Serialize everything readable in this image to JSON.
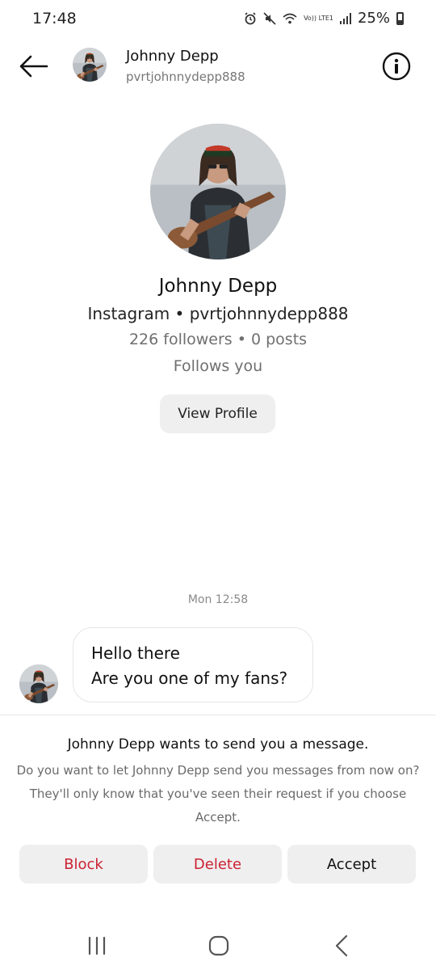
{
  "status_bar": {
    "time": "17:48",
    "network_label": "Vo)) LTE1",
    "battery": "25%",
    "icons": [
      "alarm-icon",
      "mute-icon",
      "wifi-icon",
      "lte-icon",
      "signal-icon",
      "battery-icon"
    ]
  },
  "header": {
    "name": "Johnny Depp",
    "handle": "pvrtjohnnydepp888",
    "back_icon": "arrow-left-icon",
    "info_icon": "info-circle-icon"
  },
  "profile": {
    "name": "Johnny Depp",
    "subtitle": "Instagram • pvrtjohnnydepp888",
    "stats": "226 followers • 0 posts",
    "follows": "Follows you",
    "view_profile_label": "View Profile"
  },
  "conversation": {
    "timestamp": "Mon 12:58",
    "message_lines": [
      "Hello there",
      "Are you one of my fans?"
    ]
  },
  "request": {
    "title": "Johnny Depp wants to send you a message.",
    "description": "Do you want to let Johnny Depp send you messages from now on? They'll only know that you've seen their request if you choose Accept.",
    "block_label": "Block",
    "delete_label": "Delete",
    "accept_label": "Accept"
  },
  "colors": {
    "destructive": "#cc2233",
    "button_bg": "#efefef",
    "muted_text": "#6f6f6f"
  },
  "nav_bar": {
    "icons": [
      "recent-apps-icon",
      "home-icon",
      "back-nav-icon"
    ]
  }
}
